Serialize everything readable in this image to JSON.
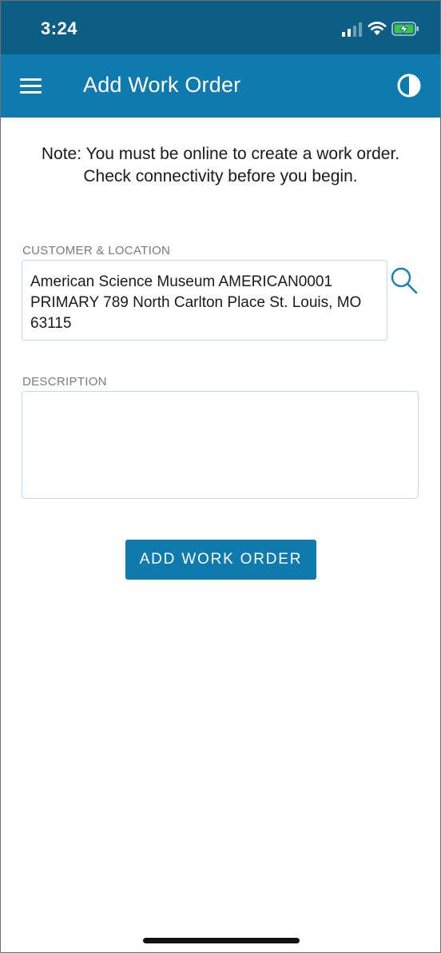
{
  "status_bar": {
    "time": "3:24",
    "icons": [
      "signal-icon",
      "wifi-icon",
      "battery-charging-icon"
    ],
    "background_color": "#0d5e85"
  },
  "header": {
    "title": "Add Work Order",
    "left_icon": "menu-icon",
    "right_icon": "contrast-icon",
    "background_color": "#0f7aad"
  },
  "note": {
    "line1": "Note: You must be online to create a work order.",
    "line2": "Check connectivity before you begin."
  },
  "customer_location": {
    "label": "CUSTOMER & LOCATION",
    "value_lines": [
      "American Science Museum AMERICAN0001",
      "PRIMARY 789 North Carlton Place St. Louis, MO",
      "63115"
    ],
    "search_icon": "search-icon"
  },
  "description": {
    "label": "DESCRIPTION",
    "value": "",
    "placeholder": ""
  },
  "actions": {
    "add_label": "ADD WORK ORDER",
    "accent_color": "#0f7aad"
  }
}
